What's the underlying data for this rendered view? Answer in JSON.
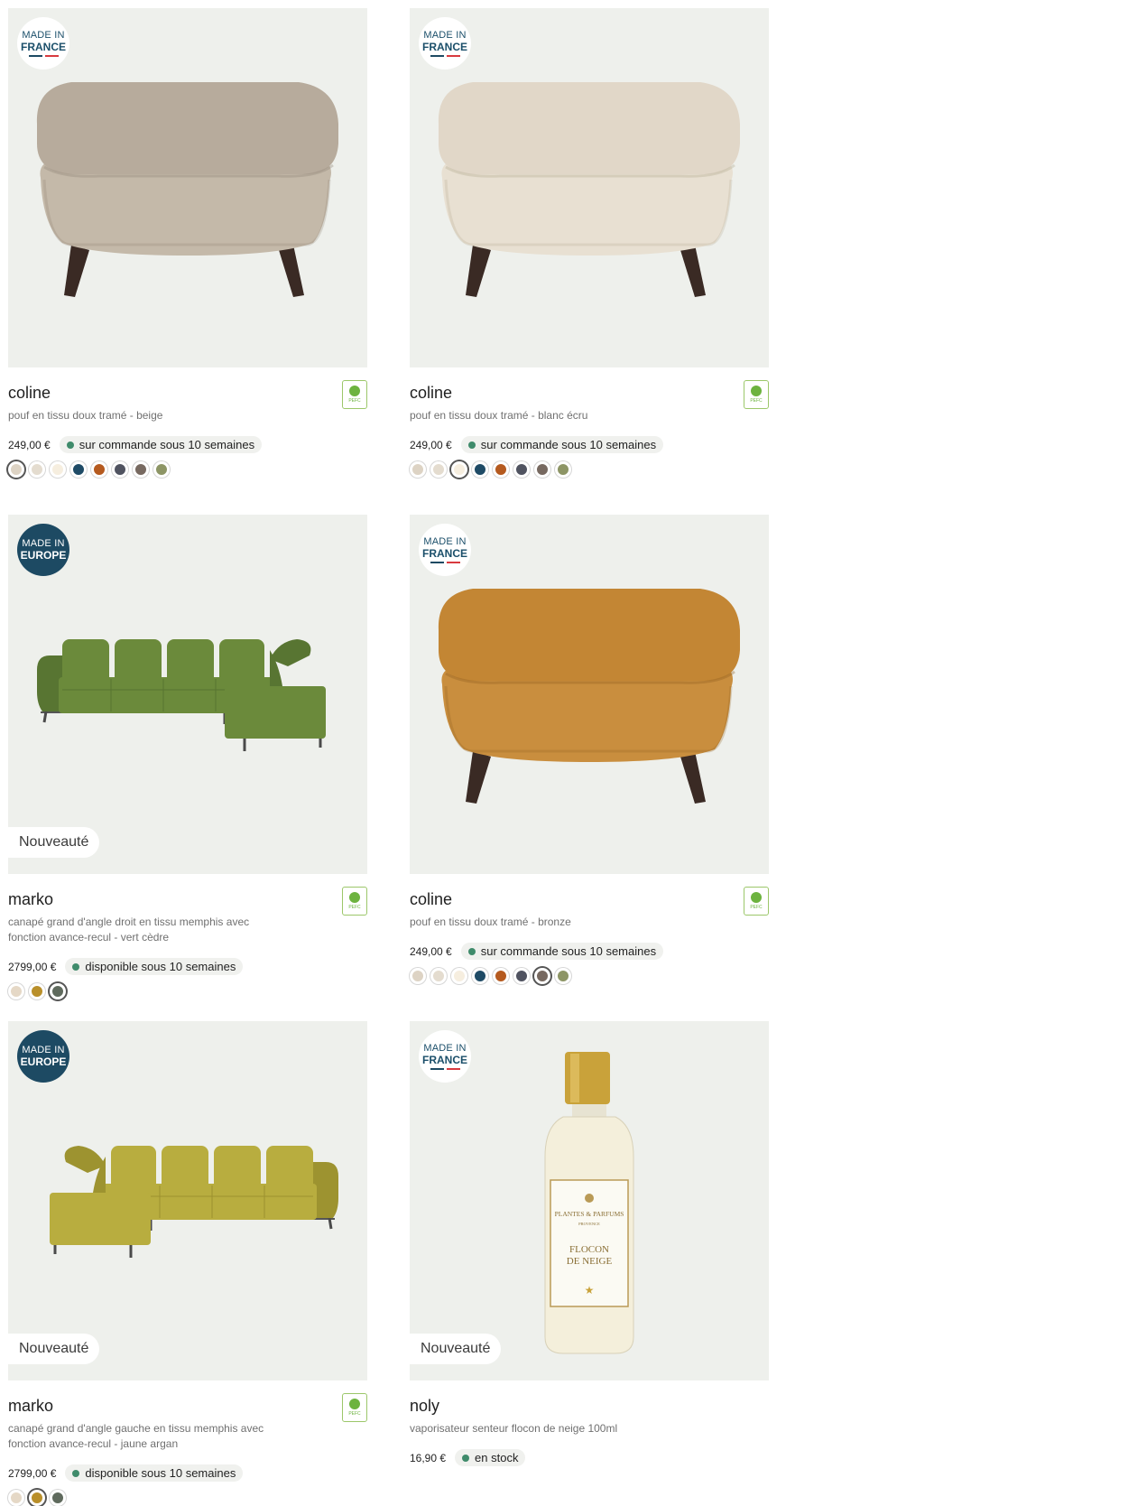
{
  "badges": {
    "france": {
      "line1": "MADE IN",
      "line2": "FRANCE"
    },
    "europe": {
      "line1": "MADE IN",
      "line2": "EUROPE"
    },
    "new_label": "Nouveauté",
    "pefc_label": "PEFC"
  },
  "products": [
    {
      "name": "coline",
      "description": "pouf en tissu doux tramé - beige",
      "price": "249,00 €",
      "status": "sur commande sous 10 semaines",
      "origin": "france",
      "is_new": false,
      "image": "beige-pouf",
      "swatches": [
        "#ddd3c4",
        "#e4dccf",
        "#f6eedf",
        "#1f4b66",
        "#b55a1f",
        "#505360",
        "#776960",
        "#8d9565"
      ],
      "selected_swatch": 0
    },
    {
      "name": "coline",
      "description": "pouf en tissu doux tramé - blanc écru",
      "price": "249,00 €",
      "status": "sur commande sous 10 semaines",
      "origin": "france",
      "is_new": false,
      "image": "ecru-pouf",
      "swatches": [
        "#ddd3c4",
        "#e4dccf",
        "#f6eedf",
        "#1f4b66",
        "#b55a1f",
        "#505360",
        "#776960",
        "#8d9565"
      ],
      "selected_swatch": 2
    },
    {
      "name": "marko",
      "description": "canapé grand d'angle droit en tissu memphis avec fonction avance-recul - vert cèdre",
      "price": "2799,00 €",
      "status": "disponible sous 10 semaines",
      "origin": "europe",
      "is_new": true,
      "image": "green-sofa",
      "swatches": [
        "#e5d8c6",
        "#b98f2a",
        "#5f6a5d"
      ],
      "selected_swatch": 2
    },
    {
      "name": "coline",
      "description": "pouf en tissu doux tramé - bronze",
      "price": "249,00 €",
      "status": "sur commande sous 10 semaines",
      "origin": "france",
      "is_new": false,
      "image": "bronze-pouf",
      "swatches": [
        "#ddd3c4",
        "#e4dccf",
        "#f6eedf",
        "#1f4b66",
        "#b55a1f",
        "#505360",
        "#776960",
        "#8d9565"
      ],
      "selected_swatch": 6
    },
    {
      "name": "marko",
      "description": "canapé grand d'angle gauche en tissu memphis avec fonction avance-recul - jaune argan",
      "price": "2799,00 €",
      "status": "disponible sous 10 semaines",
      "origin": "europe",
      "is_new": true,
      "image": "yellow-sofa",
      "swatches": [
        "#e5d8c6",
        "#b98f2a",
        "#5f6a5d"
      ],
      "selected_swatch": 1
    },
    {
      "name": "noly",
      "description": "vaporisateur senteur flocon de neige 100ml",
      "price": "16,90 €",
      "status": "en stock",
      "origin": "france",
      "is_new": true,
      "image": "perfume-bottle",
      "bottle_text": {
        "brand": "PLANTES & PARFUMS",
        "region": "PROVENCE",
        "scent_1": "FLOCON",
        "scent_2": "DE NEIGE"
      },
      "swatches": [],
      "selected_swatch": -1
    }
  ],
  "colors": {
    "status_dot": "#3f8b6b",
    "card_bg": "#eef0ec",
    "badge_navy": "#1d4a63",
    "pefc_green": "#6db33f"
  }
}
